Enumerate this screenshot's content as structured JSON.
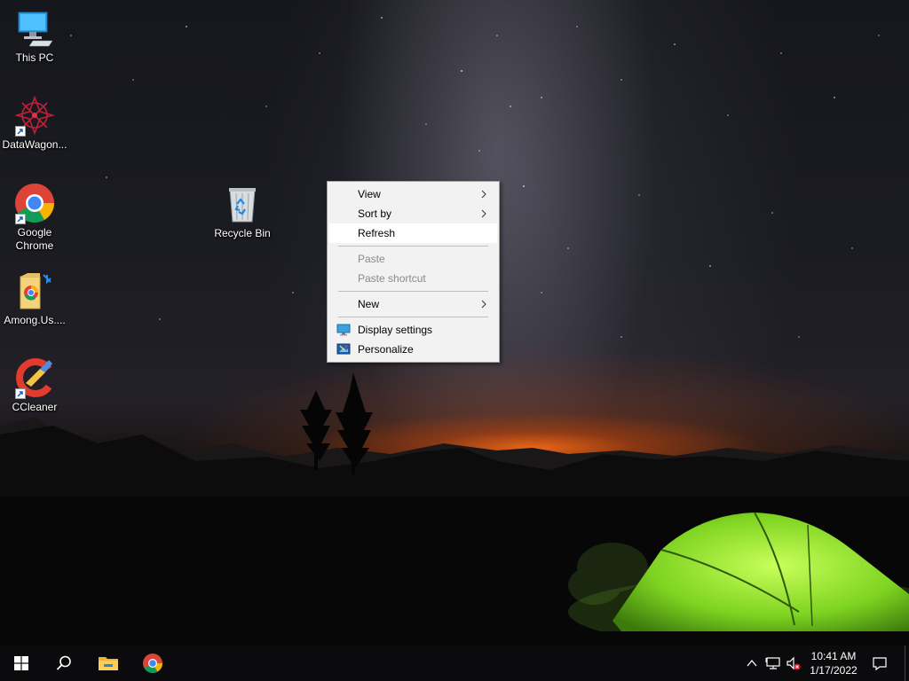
{
  "desktop": {
    "icons": [
      {
        "label": "This PC",
        "icon": "computer-icon"
      },
      {
        "label": "DataWagon...",
        "icon": "datawagon-icon"
      },
      {
        "label": "Google Chrome",
        "icon": "chrome-icon"
      },
      {
        "label": "Among.Us....",
        "icon": "among-us-icon"
      },
      {
        "label": "CCleaner",
        "icon": "ccleaner-icon"
      },
      {
        "label": "Recycle Bin",
        "icon": "recycle-bin-icon"
      }
    ]
  },
  "context_menu": {
    "items": [
      {
        "label": "View",
        "has_submenu": true
      },
      {
        "label": "Sort by",
        "has_submenu": true
      },
      {
        "label": "Refresh",
        "highlighted": true
      },
      {
        "label": "Paste",
        "disabled": true
      },
      {
        "label": "Paste shortcut",
        "disabled": true
      },
      {
        "label": "New",
        "has_submenu": true
      },
      {
        "label": "Display settings",
        "icon": "display-icon"
      },
      {
        "label": "Personalize",
        "icon": "personalize-icon"
      }
    ]
  },
  "taskbar": {
    "start_icon": "windows-logo-icon",
    "search_icon": "search-icon",
    "pinned": [
      "file-explorer-icon",
      "chrome-icon"
    ],
    "tray": {
      "icons": [
        "chevron-up-icon",
        "network-icon",
        "volume-muted-icon",
        "notification-icon"
      ],
      "time": "10:41 AM",
      "date": "1/17/2022"
    }
  },
  "colors": {
    "menu_bg": "#f2f2f2",
    "menu_hover": "#ffffff",
    "taskbar_bg": "#0b0b0d",
    "tent_green": "#7ed321"
  }
}
